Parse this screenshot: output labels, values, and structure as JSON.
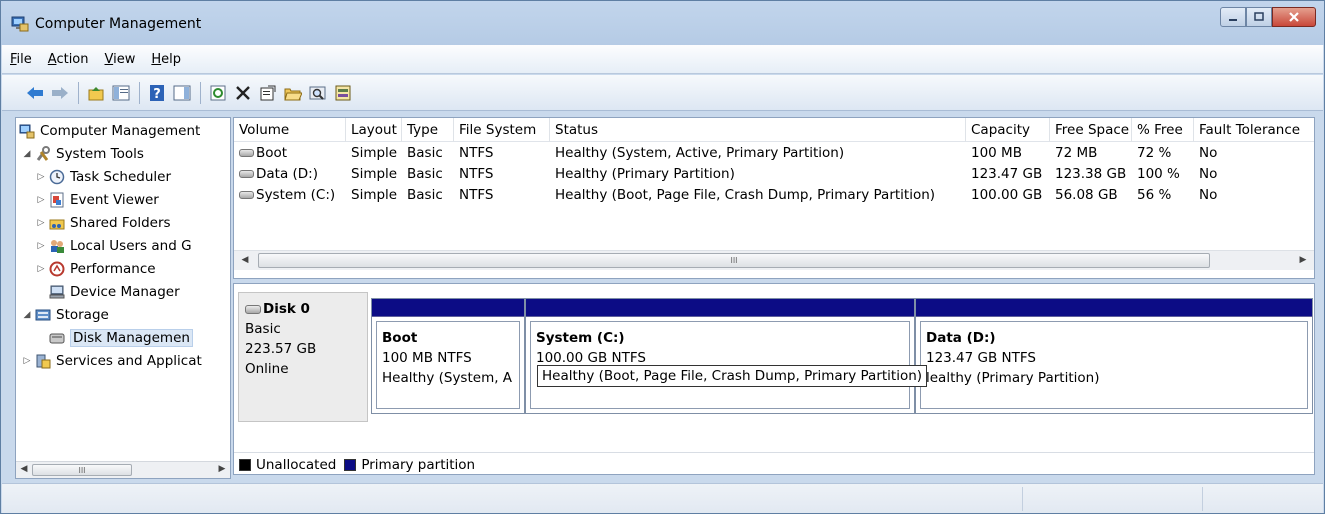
{
  "window": {
    "title": "Computer Management"
  },
  "menu": [
    {
      "label": "File",
      "u": "F",
      "rest": "ile"
    },
    {
      "label": "Action",
      "u": "A",
      "rest": "ction"
    },
    {
      "label": "View",
      "u": "V",
      "rest": "iew"
    },
    {
      "label": "Help",
      "u": "H",
      "rest": "elp"
    }
  ],
  "tree": {
    "root": "Computer Management",
    "system_tools": "System Tools",
    "task_scheduler": "Task Scheduler",
    "event_viewer": "Event Viewer",
    "shared_folders": "Shared Folders",
    "local_users": "Local Users and G",
    "performance": "Performance",
    "device_manager": "Device Manager",
    "storage": "Storage",
    "disk_management": "Disk Managemen",
    "services": "Services and Applicat"
  },
  "tree_scroll_thumb": "III",
  "volumes": {
    "headers": [
      "Volume",
      "Layout",
      "Type",
      "File System",
      "Status",
      "Capacity",
      "Free Space",
      "% Free",
      "Fault Tolerance"
    ],
    "rows": [
      [
        "Boot",
        "Simple",
        "Basic",
        "NTFS",
        "Healthy (System, Active, Primary Partition)",
        "100 MB",
        "72 MB",
        "72 %",
        "No"
      ],
      [
        "Data (D:)",
        "Simple",
        "Basic",
        "NTFS",
        "Healthy (Primary Partition)",
        "123.47 GB",
        "123.38 GB",
        "100 %",
        "No"
      ],
      [
        "System (C:)",
        "Simple",
        "Basic",
        "NTFS",
        "Healthy (Boot, Page File, Crash Dump, Primary Partition)",
        "100.00 GB",
        "56.08 GB",
        "56 %",
        "No"
      ]
    ],
    "scroll_thumb": "III"
  },
  "disk": {
    "name": "Disk 0",
    "type": "Basic",
    "size": "223.57 GB",
    "status": "Online",
    "partitions": [
      {
        "name": "Boot",
        "size": "100 MB NTFS",
        "status": "Healthy (System, A"
      },
      {
        "name": "System  (C:)",
        "size": "100.00 GB NTFS",
        "status": ""
      },
      {
        "name": "Data  (D:)",
        "size": "123.47 GB NTFS",
        "status": "lealthy (Primary Partition)"
      }
    ],
    "tooltip": "Healthy (Boot, Page File, Crash Dump, Primary Partition)"
  },
  "legend": {
    "unallocated": "Unallocated",
    "primary": "Primary partition",
    "unallocated_color": "#000000",
    "primary_color": "#0c0c85"
  }
}
